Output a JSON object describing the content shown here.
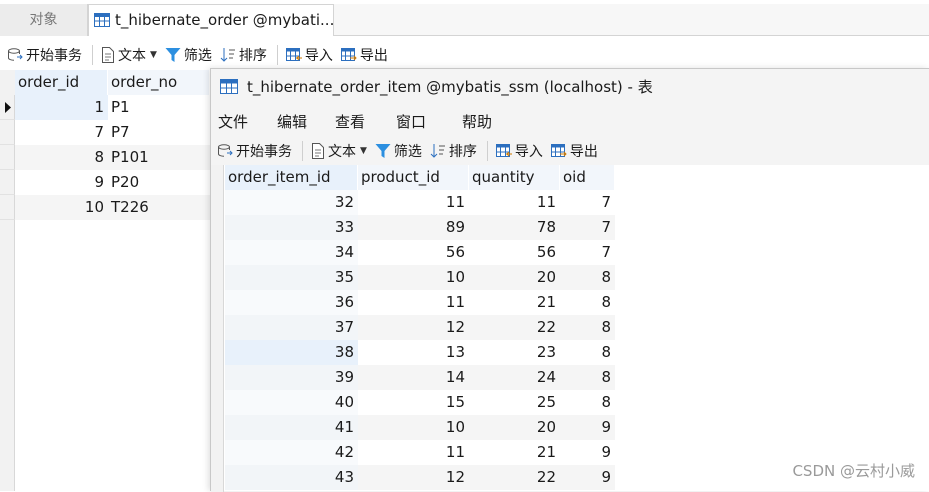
{
  "tabs": {
    "objects": "对象",
    "order_tab": "t_hibernate_order @mybati..."
  },
  "toolbar": {
    "begin": "开始事务",
    "text": "文本",
    "filter": "筛选",
    "sort": "排序",
    "import": "导入",
    "export": "导出"
  },
  "order_table": {
    "columns": [
      "order_id",
      "order_no"
    ],
    "rows": [
      {
        "order_id": "1",
        "order_no": "P1"
      },
      {
        "order_id": "7",
        "order_no": "P7"
      },
      {
        "order_id": "8",
        "order_no": "P101"
      },
      {
        "order_id": "9",
        "order_no": "P20"
      },
      {
        "order_id": "10",
        "order_no": "T226"
      }
    ]
  },
  "item_window": {
    "title": "t_hibernate_order_item @mybatis_ssm (localhost) - 表",
    "menu": [
      "文件",
      "编辑",
      "查看",
      "窗口",
      "帮助"
    ],
    "columns": [
      "order_item_id",
      "product_id",
      "quantity",
      "oid"
    ],
    "rows": [
      [
        "32",
        "11",
        "11",
        "7"
      ],
      [
        "33",
        "89",
        "78",
        "7"
      ],
      [
        "34",
        "56",
        "56",
        "7"
      ],
      [
        "35",
        "10",
        "20",
        "8"
      ],
      [
        "36",
        "11",
        "21",
        "8"
      ],
      [
        "37",
        "12",
        "22",
        "8"
      ],
      [
        "38",
        "13",
        "23",
        "8"
      ],
      [
        "39",
        "14",
        "24",
        "8"
      ],
      [
        "40",
        "15",
        "25",
        "8"
      ],
      [
        "41",
        "10",
        "20",
        "9"
      ],
      [
        "42",
        "11",
        "21",
        "9"
      ],
      [
        "43",
        "12",
        "22",
        "9"
      ]
    ]
  },
  "watermark": "CSDN @云村小威",
  "colors": {
    "header_bg": "#e8f1fb",
    "row_alt": "#f5f5f5",
    "accent": "#2c6fbf"
  }
}
